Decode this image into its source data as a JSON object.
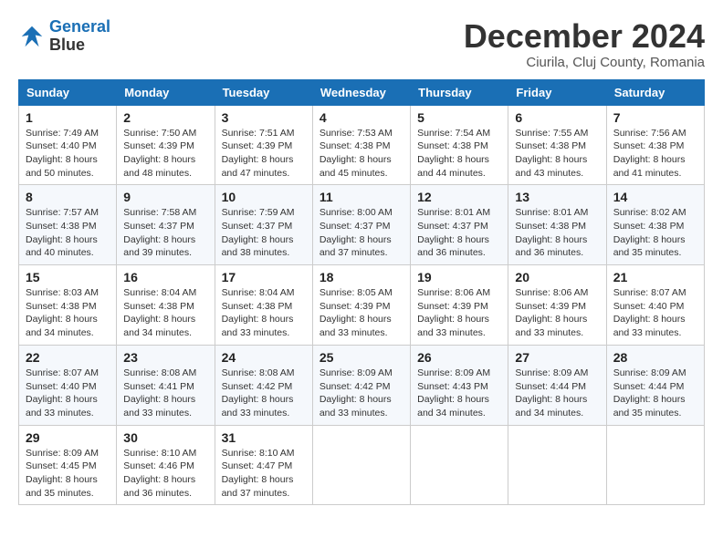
{
  "logo": {
    "line1": "General",
    "line2": "Blue"
  },
  "title": "December 2024",
  "location": "Ciurila, Cluj County, Romania",
  "weekdays": [
    "Sunday",
    "Monday",
    "Tuesday",
    "Wednesday",
    "Thursday",
    "Friday",
    "Saturday"
  ],
  "weeks": [
    [
      {
        "day": "1",
        "sunrise": "7:49 AM",
        "sunset": "4:40 PM",
        "daylight": "8 hours and 50 minutes."
      },
      {
        "day": "2",
        "sunrise": "7:50 AM",
        "sunset": "4:39 PM",
        "daylight": "8 hours and 48 minutes."
      },
      {
        "day": "3",
        "sunrise": "7:51 AM",
        "sunset": "4:39 PM",
        "daylight": "8 hours and 47 minutes."
      },
      {
        "day": "4",
        "sunrise": "7:53 AM",
        "sunset": "4:38 PM",
        "daylight": "8 hours and 45 minutes."
      },
      {
        "day": "5",
        "sunrise": "7:54 AM",
        "sunset": "4:38 PM",
        "daylight": "8 hours and 44 minutes."
      },
      {
        "day": "6",
        "sunrise": "7:55 AM",
        "sunset": "4:38 PM",
        "daylight": "8 hours and 43 minutes."
      },
      {
        "day": "7",
        "sunrise": "7:56 AM",
        "sunset": "4:38 PM",
        "daylight": "8 hours and 41 minutes."
      }
    ],
    [
      {
        "day": "8",
        "sunrise": "7:57 AM",
        "sunset": "4:38 PM",
        "daylight": "8 hours and 40 minutes."
      },
      {
        "day": "9",
        "sunrise": "7:58 AM",
        "sunset": "4:37 PM",
        "daylight": "8 hours and 39 minutes."
      },
      {
        "day": "10",
        "sunrise": "7:59 AM",
        "sunset": "4:37 PM",
        "daylight": "8 hours and 38 minutes."
      },
      {
        "day": "11",
        "sunrise": "8:00 AM",
        "sunset": "4:37 PM",
        "daylight": "8 hours and 37 minutes."
      },
      {
        "day": "12",
        "sunrise": "8:01 AM",
        "sunset": "4:37 PM",
        "daylight": "8 hours and 36 minutes."
      },
      {
        "day": "13",
        "sunrise": "8:01 AM",
        "sunset": "4:38 PM",
        "daylight": "8 hours and 36 minutes."
      },
      {
        "day": "14",
        "sunrise": "8:02 AM",
        "sunset": "4:38 PM",
        "daylight": "8 hours and 35 minutes."
      }
    ],
    [
      {
        "day": "15",
        "sunrise": "8:03 AM",
        "sunset": "4:38 PM",
        "daylight": "8 hours and 34 minutes."
      },
      {
        "day": "16",
        "sunrise": "8:04 AM",
        "sunset": "4:38 PM",
        "daylight": "8 hours and 34 minutes."
      },
      {
        "day": "17",
        "sunrise": "8:04 AM",
        "sunset": "4:38 PM",
        "daylight": "8 hours and 33 minutes."
      },
      {
        "day": "18",
        "sunrise": "8:05 AM",
        "sunset": "4:39 PM",
        "daylight": "8 hours and 33 minutes."
      },
      {
        "day": "19",
        "sunrise": "8:06 AM",
        "sunset": "4:39 PM",
        "daylight": "8 hours and 33 minutes."
      },
      {
        "day": "20",
        "sunrise": "8:06 AM",
        "sunset": "4:39 PM",
        "daylight": "8 hours and 33 minutes."
      },
      {
        "day": "21",
        "sunrise": "8:07 AM",
        "sunset": "4:40 PM",
        "daylight": "8 hours and 33 minutes."
      }
    ],
    [
      {
        "day": "22",
        "sunrise": "8:07 AM",
        "sunset": "4:40 PM",
        "daylight": "8 hours and 33 minutes."
      },
      {
        "day": "23",
        "sunrise": "8:08 AM",
        "sunset": "4:41 PM",
        "daylight": "8 hours and 33 minutes."
      },
      {
        "day": "24",
        "sunrise": "8:08 AM",
        "sunset": "4:42 PM",
        "daylight": "8 hours and 33 minutes."
      },
      {
        "day": "25",
        "sunrise": "8:09 AM",
        "sunset": "4:42 PM",
        "daylight": "8 hours and 33 minutes."
      },
      {
        "day": "26",
        "sunrise": "8:09 AM",
        "sunset": "4:43 PM",
        "daylight": "8 hours and 34 minutes."
      },
      {
        "day": "27",
        "sunrise": "8:09 AM",
        "sunset": "4:44 PM",
        "daylight": "8 hours and 34 minutes."
      },
      {
        "day": "28",
        "sunrise": "8:09 AM",
        "sunset": "4:44 PM",
        "daylight": "8 hours and 35 minutes."
      }
    ],
    [
      {
        "day": "29",
        "sunrise": "8:09 AM",
        "sunset": "4:45 PM",
        "daylight": "8 hours and 35 minutes."
      },
      {
        "day": "30",
        "sunrise": "8:10 AM",
        "sunset": "4:46 PM",
        "daylight": "8 hours and 36 minutes."
      },
      {
        "day": "31",
        "sunrise": "8:10 AM",
        "sunset": "4:47 PM",
        "daylight": "8 hours and 37 minutes."
      },
      {
        "day": "",
        "sunrise": "",
        "sunset": "",
        "daylight": ""
      },
      {
        "day": "",
        "sunrise": "",
        "sunset": "",
        "daylight": ""
      },
      {
        "day": "",
        "sunrise": "",
        "sunset": "",
        "daylight": ""
      },
      {
        "day": "",
        "sunrise": "",
        "sunset": "",
        "daylight": ""
      }
    ]
  ],
  "labels": {
    "sunrise": "Sunrise:",
    "sunset": "Sunset:",
    "daylight": "Daylight:"
  }
}
